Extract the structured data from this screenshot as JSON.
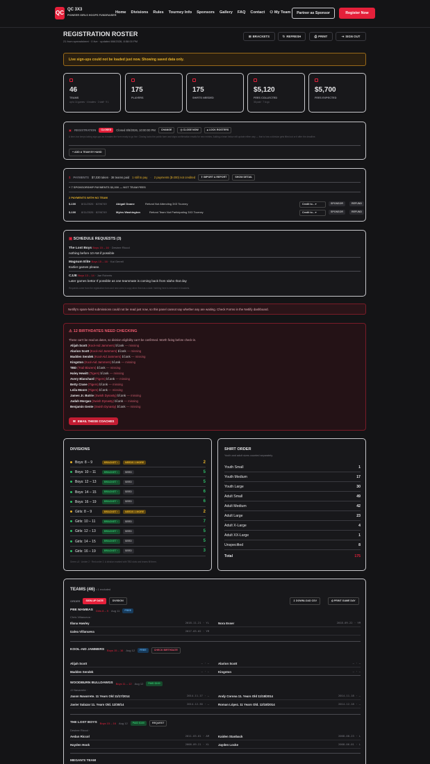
{
  "nav": {
    "logo": "QC",
    "brand": "QC 3X3",
    "tagline": "PIONEER GIRLS HOOPS FUNDRAISER",
    "links": [
      "Home",
      "Divisions",
      "Rules",
      "Tourney Info",
      "Sponsors",
      "Gallery",
      "FAQ",
      "Contact",
      "My Team"
    ],
    "partner": "Partner as Sponsor",
    "register": "Register Now"
  },
  "header": {
    "title": "REGISTRATION ROSTER",
    "subtitle": "21 from spreadsheet · 0 live · updated 8/8/2026, 8:58:00 PM",
    "buttons": [
      "BRACKETS",
      "REFRESH",
      "PRINT",
      "SIGN OUT"
    ]
  },
  "alert": "Live sign-ups could not be loaded just now. Showing saved data only.",
  "stats": [
    {
      "value": "46",
      "label": "TEAMS",
      "detail": "up to 14 games · 4 leaders · 2 staff · 9 1"
    },
    {
      "value": "175",
      "label": "PLAYERS",
      "detail": ""
    },
    {
      "value": "175",
      "label": "SHIRTS NEEDED",
      "detail": ""
    },
    {
      "value": "$5,120",
      "label": "FEES COLLECTED",
      "detail": "36 paid · 7 to go"
    },
    {
      "value": "$5,700",
      "label": "FEES EXPECTED",
      "detail": ""
    }
  ],
  "registration": {
    "label": "REGISTRATION",
    "status": "CLOSED",
    "closed": "Closed 8/8/2026, 10:00:00 PM",
    "change": "CHANGE",
    "close_now": "CLOSE NOW",
    "lock": "LOCK ROSTERS",
    "note": "A time-box keeps taking sign-ups as it makes the form ready to go live. Closing locks the public form and stops confirmation emails for new entries. Adding a team below will update either way — that is how a division gets filled out or it after the deadline.",
    "add": "ADD A TEAM BY HAND"
  },
  "payments": {
    "label": "PAYMENTS",
    "summary": "$7,030 taken · 38 teams paid",
    "to_pay": "1 still to pay",
    "unmatched": "2 payments ($-200) not credited",
    "import": "IMPORT A REPORT",
    "detail": "SHOW DETAIL",
    "sponsor_line": "+ 7 SPONSORSHIP PAYMENTS $3,300 — NOT TEAM FEES",
    "noteam": "2 PAYMENTS WITH NO TEAM",
    "rows": [
      {
        "amt": "$-100",
        "date": "8/11/2026 · 8296749",
        "name": "Abigail Doane",
        "memo": "Refund Not Attending 3X3 Tourney",
        "sel": "Credit to...",
        "b1": "SPONSOR",
        "b2": "REFUND"
      },
      {
        "amt": "$-100",
        "date": "8/11/2026 · 8296749",
        "name": "Myles Washington",
        "memo": "Refund Team Not Participating 3X3 Tourney",
        "sel": "Credit to...",
        "b1": "SPONSOR",
        "b2": "REFUND"
      }
    ]
  },
  "schedule": {
    "title": "SCHEDULE REQUESTS (3)",
    "items": [
      {
        "team": "The Lost Boys",
        "div": "Boys 15 – 16",
        "who": "Desiree Riccol",
        "text": "nothing before 10 AM if possible"
      },
      {
        "team": "Magnum Elite",
        "div": "Boys 15 – 16",
        "who": "Kai Gerrell",
        "text": "Earlier games please."
      },
      {
        "team": "CJJE",
        "div": "Boys 13 – 14",
        "who": "Jae Roberts",
        "text": "Later games bettor If possible as one teammate is coming back from Idaho that day"
      }
    ],
    "footer": "Requests come from the registration form and new ones in copy when fixed as a date. Nothing here is enforced in brackets."
  },
  "netlify": "Netlify's spam-held submissions could not be read just now, so this panel cannot say whether any are waiting. Check Forms in the Netlify dashboard.",
  "birthdates": {
    "title": "12 BIRTHDATES NEED CHECKING",
    "sub": "These can't be read as dates, so division eligibility can't be confirmed. Worth fixing before check-in.",
    "rows": [
      {
        "name": "Alijah Scott",
        "team": "(Kool-Aid Jammers)",
        "val": "blank",
        "note": "— missing"
      },
      {
        "name": "Alarion Scott",
        "team": "(Kool-Aid Jammers)",
        "val": "blank",
        "note": "— missing"
      },
      {
        "name": "Madden Sendek",
        "team": "(Kool-Aid Jammers)",
        "val": "blank",
        "note": "— missing"
      },
      {
        "name": "Kingston",
        "team": "(Kool-Aid Jammers)",
        "val": "blank",
        "note": "— missing"
      },
      {
        "name": "TBD",
        "team": "(Trail Blazers)",
        "val": "blank",
        "note": "— missing"
      },
      {
        "name": "Haley Hewitt",
        "team": "(Tigers)",
        "val": "blank",
        "note": "— missing"
      },
      {
        "name": "Avery Blanchard",
        "team": "(Tigers)",
        "val": "blank",
        "note": "— missing"
      },
      {
        "name": "Betty Crane",
        "team": "(Tigers)",
        "val": "blank",
        "note": "— missing"
      },
      {
        "name": "Leila Moore",
        "team": "(Tigers)",
        "val": "blank",
        "note": "— missing"
      },
      {
        "name": "James Jr. Butrie",
        "team": "(Swish Dynasty)",
        "val": "blank",
        "note": "— missing"
      },
      {
        "name": "Judah Morgan",
        "team": "(Swish Dynasty)",
        "val": "blank",
        "note": "— missing"
      },
      {
        "name": "Benjamin Gente",
        "team": "(Swish Dynasty)",
        "val": "blank",
        "note": "— missing"
      }
    ],
    "email": "EMAIL THESE COACHES"
  },
  "divisions": {
    "title": "DIVISIONS",
    "rows": [
      {
        "name": "Boys: 8 – 9",
        "p1": "BRACKET ›",
        "p2": "NEEDS 1 MORE",
        "count": "2",
        "warn": true
      },
      {
        "name": "Boys: 10 – 11",
        "p1": "BRACKET ›",
        "p2": "SEED",
        "count": "5",
        "warn": false
      },
      {
        "name": "Boys: 12 – 13",
        "p1": "BRACKET ›",
        "p2": "SEED",
        "count": "5",
        "warn": false
      },
      {
        "name": "Boys: 14 – 15",
        "p1": "BRACKET ›",
        "p2": "SEED",
        "count": "6",
        "warn": false
      },
      {
        "name": "Boys: 16 – 19",
        "p1": "BRACKET ›",
        "p2": "SEED",
        "count": "6",
        "warn": false
      },
      {
        "name": "Girls: 8 – 9",
        "p1": "BRACKET ›",
        "p2": "NEEDS 1 MORE",
        "count": "2",
        "warn": true
      },
      {
        "name": "Girls: 10 – 11",
        "p1": "BRACKET ›",
        "p2": "SEED",
        "count": "7",
        "warn": false
      },
      {
        "name": "Girls: 12 – 13",
        "p1": "BRACKET ›",
        "p2": "SEED",
        "count": "5",
        "warn": false
      },
      {
        "name": "Girls: 14 – 15",
        "p1": "BRACKET ›",
        "p2": "SEED",
        "count": "5",
        "warn": false
      },
      {
        "name": "Girls: 16 – 19",
        "p1": "BRACKET ›",
        "p2": "SEED",
        "count": "3",
        "warn": false
      }
    ],
    "foot": "Green ≥3 · Amber 2 · Red under 2. A division marked with TBD slots and teams fill them."
  },
  "shirts": {
    "title": "SHIRT ORDER",
    "sub": "Youth and adult sizes counted separately.",
    "rows": [
      {
        "size": "Youth Small",
        "n": "1"
      },
      {
        "size": "Youth Medium",
        "n": "17"
      },
      {
        "size": "Youth Large",
        "n": "30"
      },
      {
        "size": "Adult Small",
        "n": "49"
      },
      {
        "size": "Adult Medium",
        "n": "42"
      },
      {
        "size": "Adult Large",
        "n": "23"
      },
      {
        "size": "Adult X-Large",
        "n": "4"
      },
      {
        "size": "Adult XX-Large",
        "n": "1"
      },
      {
        "size": "Unspecified",
        "n": "8"
      }
    ],
    "total_label": "Total",
    "total": "175"
  },
  "teams": {
    "title": "TEAMS (46)",
    "sub": "• 1 excluded",
    "order": "ORDER",
    "sort1": "SIGN-UP DATE",
    "sort2": "DIVISION",
    "download": "DOWNLOAD CSV",
    "print": "PRINT GAME DAY",
    "blocks": [
      {
        "name": "PBE MAMBAS",
        "div": "Girls 8 – 9",
        "date": "Aug 11",
        "badge": "FREE",
        "coach": "Chris Villanueva ·",
        "players": [
          [
            "Illana Hawley",
            "2018-11-21 · YL",
            "Nora Esser",
            "2018-09-22 · YM"
          ],
          [
            "Izalea Villanueva",
            "2017-03-02 · YM",
            "",
            ""
          ]
        ]
      },
      {
        "name": "KOOL-AID JAMMERS",
        "div": "Boys 15 – 16",
        "date": "Aug 12",
        "badge": "FREE",
        "extra": "CHECK BIRTHDATE",
        "coach": "",
        "players": [
          [
            "Alijah Scott",
            "— · —",
            "Alarion Scott",
            "— · —"
          ],
          [
            "Madden Sendek",
            "— · —",
            "Kingston",
            "— · —"
          ]
        ]
      },
      {
        "name": "WOODBURN BULLDAWGS",
        "div": "Boys 11 – 12",
        "date": "Aug 12",
        "badge": "PAID $160",
        "coach": "JJ Navarrete ·",
        "players": [
          [
            "Jaxon Navarrete. 11 Years Old 11/17/2014",
            "2014-11-17 · —",
            "Andy Corona 11. Years Old 11/18/2014",
            "2014-11-18 · —"
          ],
          [
            "Javier Salazar 11. Years Old. 12/30/14",
            "2014-12-30 · —",
            "Roman López. 11 Years Old. 12/18/2014",
            "2014-12-18 · —"
          ]
        ]
      },
      {
        "name": "THE LOST BOYS",
        "div": "Boys 15 – 16",
        "date": "Aug 12",
        "badge": "PAID $160",
        "extra": "REQUEST",
        "coach": "Desiree Riccol ·",
        "players": [
          [
            "Aedan Riccol",
            "2011-03-01 · AM",
            "Kaiden Stanback",
            "2008-08-23 · L"
          ],
          [
            "Hayden Hook",
            "2008-09-21 · XL",
            "Jayden Locke",
            "2008-06-01 · L"
          ]
        ]
      },
      {
        "name": "MEGAN'S TEAM",
        "div": "",
        "date": "",
        "badge": "",
        "coach": "",
        "players": []
      }
    ]
  },
  "colors": {
    "accent": "#e5203a",
    "warn": "#e8b32a",
    "ok": "#2fbf6a",
    "bg": "#141416"
  }
}
